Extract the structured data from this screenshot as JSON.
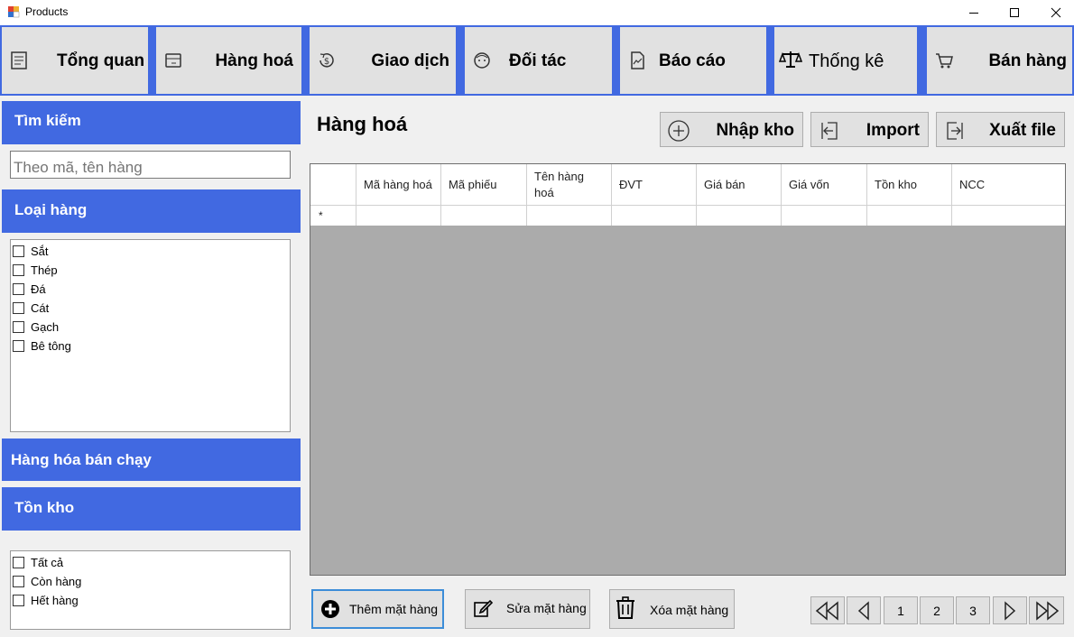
{
  "window": {
    "title": "Products"
  },
  "nav": {
    "items": [
      {
        "label": "Tổng quan",
        "icon": "document-icon"
      },
      {
        "label": "Hàng hoá",
        "icon": "box-icon"
      },
      {
        "label": "Giao dịch",
        "icon": "dollar-cycle-icon"
      },
      {
        "label": "Đối tác",
        "icon": "partner-face-icon"
      },
      {
        "label": "Báo cáo",
        "icon": "report-chart-icon"
      },
      {
        "label": "Thống kê",
        "icon": "scale-icon"
      },
      {
        "label": "Bán hàng",
        "icon": "cart-icon"
      }
    ]
  },
  "sidebar": {
    "search_heading": "Tìm kiếm",
    "search_placeholder": "Theo mã, tên hàng",
    "category_heading": "Loại hàng",
    "categories": [
      "Sắt",
      "Thép",
      "Đá",
      "Cát",
      "Gạch",
      "Bê tông"
    ],
    "bestseller_heading": "Hàng hóa bán chạy",
    "stock_heading": "Tồn kho",
    "stock_options": [
      "Tất cả",
      "Còn hàng",
      "Hết hàng"
    ]
  },
  "main": {
    "title": "Hàng hoá",
    "actions": {
      "import_stock": "Nhập kho",
      "import": "Import",
      "export": "Xuất file"
    },
    "table": {
      "columns": [
        "Mã hàng hoá",
        "Mã phiếu",
        "Tên hàng hoá",
        "ĐVT",
        "Giá bán",
        "Giá vốn",
        "Tồn kho",
        "NCC"
      ],
      "new_row_marker": "*"
    },
    "bottom": {
      "add": "Thêm mặt hàng",
      "edit": "Sửa mặt hàng",
      "delete": "Xóa mặt hàng"
    },
    "pagination": {
      "pages": [
        "1",
        "2",
        "3"
      ]
    }
  },
  "colors": {
    "accent": "#4169e1",
    "button": "#e1e1e1",
    "grid_bg": "#ababab"
  }
}
